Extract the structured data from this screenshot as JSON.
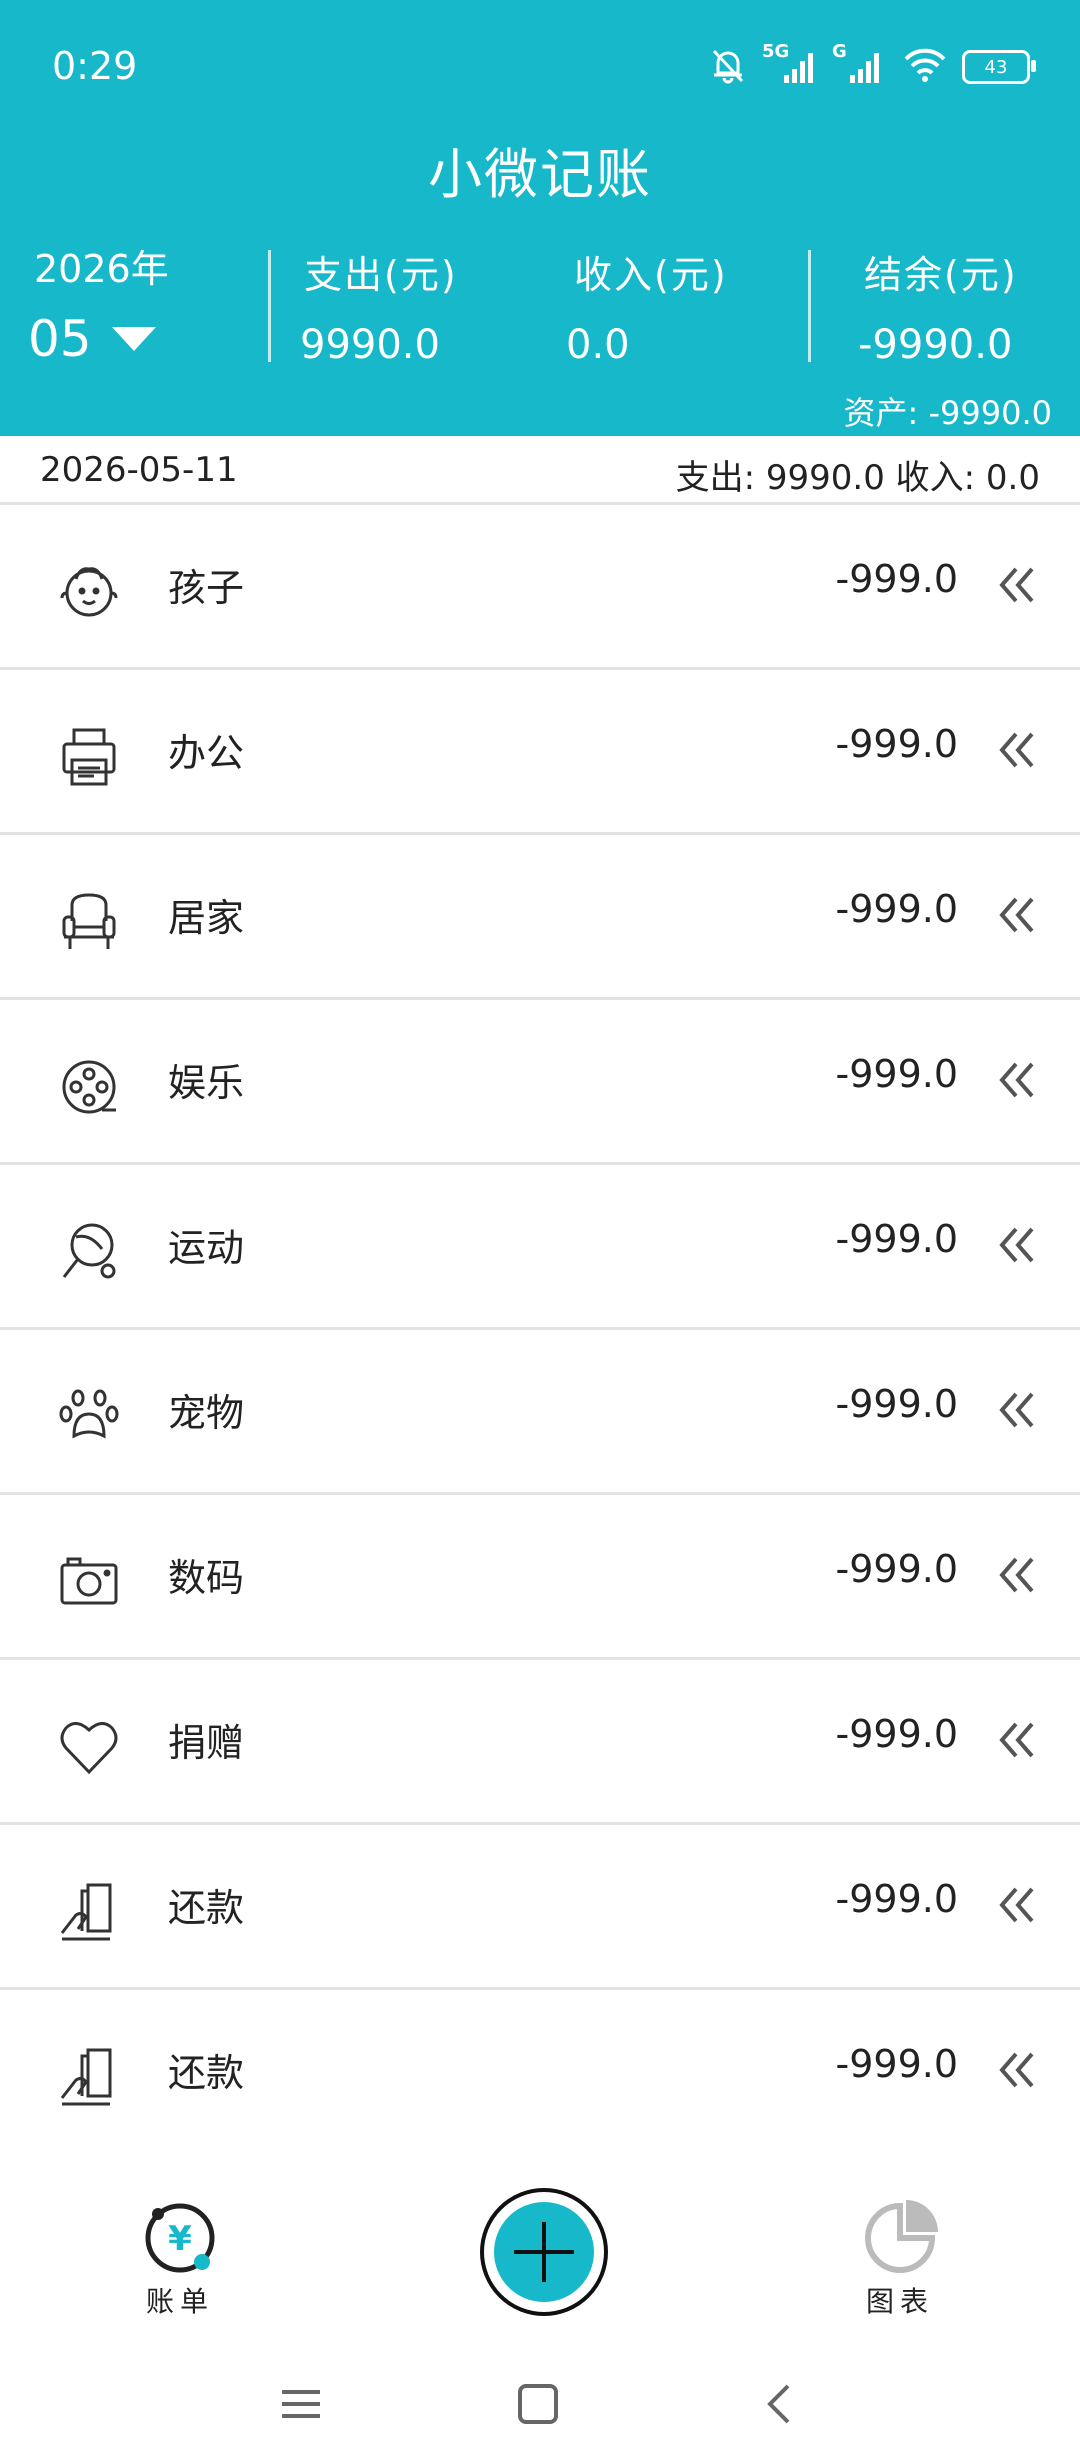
{
  "status_bar": {
    "time": "0:29",
    "network_1": "5G",
    "network_2": "G",
    "battery": "43"
  },
  "header": {
    "title": "小微记账",
    "year": "2026年",
    "month": "05",
    "expense_label": "支出(元)",
    "expense_value": "9990.0",
    "income_label": "收入(元)",
    "income_value": "0.0",
    "balance_label": "结余(元)",
    "balance_value": "-9990.0",
    "asset": "资产: -9990.0",
    "accent_color": "#17b8c9"
  },
  "day": {
    "date": "2026-05-11",
    "summary": "支出: 9990.0 收入: 0.0"
  },
  "items": [
    {
      "icon": "baby-icon",
      "label": "孩子",
      "amount": "-999.0"
    },
    {
      "icon": "printer-icon",
      "label": "办公",
      "amount": "-999.0"
    },
    {
      "icon": "armchair-icon",
      "label": "居家",
      "amount": "-999.0"
    },
    {
      "icon": "film-reel-icon",
      "label": "娱乐",
      "amount": "-999.0"
    },
    {
      "icon": "ping-pong-icon",
      "label": "运动",
      "amount": "-999.0"
    },
    {
      "icon": "paw-icon",
      "label": "宠物",
      "amount": "-999.0"
    },
    {
      "icon": "camera-icon",
      "label": "数码",
      "amount": "-999.0"
    },
    {
      "icon": "heart-icon",
      "label": "捐赠",
      "amount": "-999.0"
    },
    {
      "icon": "hand-card-icon",
      "label": "还款",
      "amount": "-999.0"
    },
    {
      "icon": "hand-card-icon",
      "label": "还款",
      "amount": "-999.0"
    }
  ],
  "bottom_nav": {
    "bills_label": "账单",
    "charts_label": "图表"
  }
}
